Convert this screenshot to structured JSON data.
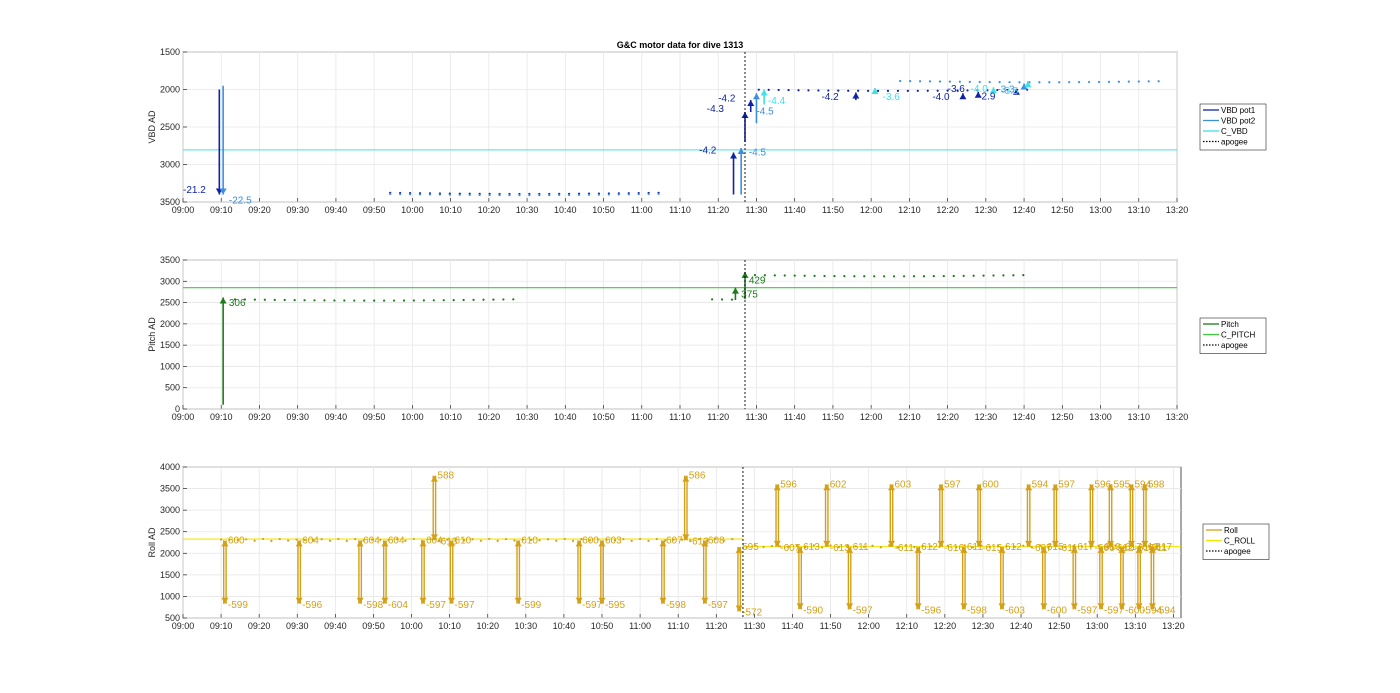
{
  "title": "G&C motor data for dive 1313",
  "x_ticks": [
    "09:00",
    "09:10",
    "09:20",
    "09:30",
    "09:40",
    "09:50",
    "10:00",
    "10:10",
    "10:20",
    "10:30",
    "10:40",
    "10:50",
    "11:00",
    "11:10",
    "11:20",
    "11:30",
    "11:40",
    "11:50",
    "12:00",
    "12:10",
    "12:20",
    "12:30",
    "12:40",
    "12:50",
    "13:00",
    "13:10",
    "13:20"
  ],
  "chart_data": [
    {
      "type": "line",
      "ylabel": "VBD AD",
      "ylim": [
        1500,
        3500
      ],
      "y_reversed": true,
      "yticks": [
        1500,
        2000,
        2500,
        3000,
        3500
      ],
      "xlim_minutes": [
        0,
        260
      ],
      "apogee_minute": 147,
      "grid": true,
      "legend_position": "right",
      "legend": [
        {
          "label": "VBD pot1",
          "color": "#0f23a8",
          "style": "solid"
        },
        {
          "label": "VBD pot2",
          "color": "#3b8fe0",
          "style": "solid"
        },
        {
          "label": "C_VBD",
          "color": "#40e0e8",
          "style": "solid"
        },
        {
          "label": "apogee",
          "color": "#000000",
          "style": "dotted"
        }
      ],
      "constant_line": {
        "name": "C_VBD",
        "y": 2805,
        "color": "#40e0e8"
      },
      "series": [
        {
          "name": "VBD pot1",
          "color": "#0f23a8",
          "baseline_segments": [
            [
              10,
              3380,
              146,
              3380
            ],
            [
              148,
              2005,
              256,
              2005
            ]
          ]
        },
        {
          "name": "VBD pot2",
          "color": "#3b8fe0",
          "baseline_segments": [
            [
              10,
              3395,
              146,
              3395
            ],
            [
              146,
              1890,
              256,
              1890
            ]
          ]
        }
      ],
      "arrows": [
        {
          "x": 9.5,
          "y0": 2000,
          "y1": 3400,
          "color": "#0f23a8",
          "label": "-21.2",
          "lx": 0,
          "ly": 3380
        },
        {
          "x": 10.5,
          "y0": 1950,
          "y1": 3400,
          "color": "#3b8fe0",
          "label": "-22.5",
          "lx": 12,
          "ly": 3520
        },
        {
          "x": 144,
          "y0": 3400,
          "y1": 2840,
          "color": "#0f23a8",
          "label": "-4.2",
          "lx": 135,
          "ly": 2850
        },
        {
          "x": 146,
          "y0": 3400,
          "y1": 2780,
          "color": "#3b8fe0",
          "label": "-4.5",
          "lx": 148,
          "ly": 2880
        },
        {
          "x": 147,
          "y0": 2700,
          "y1": 2300,
          "color": "#0f23a8",
          "label": "-4.3",
          "lx": 137,
          "ly": 2300
        },
        {
          "x": 148.5,
          "y0": 2300,
          "y1": 2140,
          "color": "#0f23a8",
          "label": "-4.2",
          "lx": 140,
          "ly": 2160
        },
        {
          "x": 150,
          "y0": 2450,
          "y1": 2050,
          "color": "#3b8fe0",
          "label": "-4.5",
          "lx": 150,
          "ly": 2330
        },
        {
          "x": 152,
          "y0": 2200,
          "y1": 2000,
          "color": "#40e0e8",
          "label": "-4.4",
          "lx": 153,
          "ly": 2190
        },
        {
          "x": 176,
          "y0": 2140,
          "y1": 2040,
          "color": "#0f23a8",
          "label": "-4.2",
          "lx": 167,
          "ly": 2140
        },
        {
          "x": 181,
          "y0": 2050,
          "y1": 1980,
          "color": "#40e0e8",
          "label": "-3.6",
          "lx": 183,
          "ly": 2140
        },
        {
          "x": 204,
          "y0": 2090,
          "y1": 2050,
          "color": "#0f23a8",
          "label": "-4.0",
          "lx": 196,
          "ly": 2140
        },
        {
          "x": 208,
          "y0": 2070,
          "y1": 2030,
          "color": "#0f23a8",
          "label": "-3.6",
          "lx": 200,
          "ly": 2030
        },
        {
          "x": 212,
          "y0": 2020,
          "y1": 1970,
          "color": "#40e0e8",
          "label": "-4.0",
          "lx": 206,
          "ly": 2030
        },
        {
          "x": 218,
          "y0": 2040,
          "y1": 1990,
          "color": "#0f23a8",
          "label": "-2.9",
          "lx": 208,
          "ly": 2130
        },
        {
          "x": 220,
          "y0": 2000,
          "y1": 1920,
          "color": "#3b8fe0",
          "label": "-3.3",
          "lx": 213,
          "ly": 2040
        },
        {
          "x": 221,
          "y0": 1960,
          "y1": 1890,
          "color": "#40e0e8",
          "label": "-3.5",
          "lx": 214,
          "ly": 2060
        }
      ]
    },
    {
      "type": "line",
      "ylabel": "Pitch AD",
      "ylim": [
        0,
        3500
      ],
      "yticks": [
        0,
        500,
        1000,
        1500,
        2000,
        2500,
        3000,
        3500
      ],
      "xlim_minutes": [
        0,
        260
      ],
      "apogee_minute": 147,
      "grid": true,
      "legend_position": "right",
      "legend": [
        {
          "label": "Pitch",
          "color": "#1b7a1b",
          "style": "solid"
        },
        {
          "label": "C_PITCH",
          "color": "#3ccc3c",
          "style": "solid"
        },
        {
          "label": "apogee",
          "color": "#000000",
          "style": "dotted"
        }
      ],
      "constant_line": {
        "name": "C_PITCH",
        "y": 2850,
        "color": "#3ccc3c"
      },
      "series": [
        {
          "name": "Pitch",
          "color": "#1b7a1b",
          "baseline_segments": [
            [
              11,
              2570,
              145,
              2570
            ],
            [
              147,
              3140,
              256,
              3140
            ]
          ]
        }
      ],
      "arrows": [
        {
          "x": 10.5,
          "y0": 100,
          "y1": 2620,
          "color": "#1b7a1b",
          "label": "306",
          "lx": 12,
          "ly": 2420
        },
        {
          "x": 144.5,
          "y0": 2560,
          "y1": 2850,
          "color": "#1b7a1b",
          "label": "",
          "lx": 0,
          "ly": 0
        },
        {
          "x": 147,
          "y0": 2580,
          "y1": 3220,
          "color": "#1b7a1b",
          "label": "429",
          "lx": 148,
          "ly": 2950
        },
        {
          "x": 147,
          "y0": 0,
          "y1": 0,
          "color": "#1b7a1b",
          "label": "375",
          "lx": 146,
          "ly": 2620
        }
      ]
    },
    {
      "type": "line",
      "ylabel": "Roll AD",
      "ylim": [
        500,
        4000
      ],
      "yticks": [
        500,
        1000,
        1500,
        2000,
        2500,
        3000,
        3500,
        4000
      ],
      "xlim_minutes": [
        0,
        262
      ],
      "apogee_minute": 147,
      "grid": true,
      "legend_position": "right",
      "legend": [
        {
          "label": "Roll",
          "color": "#d4a017",
          "style": "solid"
        },
        {
          "label": "C_ROLL",
          "color": "#f2e600",
          "style": "solid"
        },
        {
          "label": "apogee",
          "color": "#000000",
          "style": "dotted"
        }
      ],
      "constant_line": {
        "name": "C_ROLL",
        "y1": 2330,
        "y2": 2160,
        "color": "#f2e600"
      },
      "series": [
        {
          "name": "Roll",
          "color": "#d4a017",
          "baseline_segments": [
            [
              10,
              2310,
              145,
              2310
            ],
            [
              148,
              2160,
              256,
              2160
            ]
          ]
        }
      ],
      "spikes": [
        {
          "x": 11,
          "top": 2300,
          "bot": 830,
          "labels": [
            "600",
            "-599"
          ]
        },
        {
          "x": 30.5,
          "top": 2300,
          "bot": 830,
          "labels": [
            "604",
            "-596"
          ]
        },
        {
          "x": 46.5,
          "top": 2300,
          "bot": 830,
          "labels": [
            "604",
            "-598"
          ]
        },
        {
          "x": 53,
          "top": 2300,
          "bot": 830,
          "labels": [
            "604",
            "-604"
          ]
        },
        {
          "x": 63,
          "top": 2300,
          "bot": 830,
          "labels": [
            "604",
            "-597"
          ]
        },
        {
          "x": 66,
          "top": 3800,
          "bot": 2300,
          "labels": [
            "588",
            "-613"
          ]
        },
        {
          "x": 70.5,
          "top": 2300,
          "bot": 830,
          "labels": [
            "610",
            "-597"
          ]
        },
        {
          "x": 88,
          "top": 2300,
          "bot": 830,
          "labels": [
            "610",
            "-599"
          ]
        },
        {
          "x": 104,
          "top": 2300,
          "bot": 830,
          "labels": [
            "600",
            "-597"
          ]
        },
        {
          "x": 110,
          "top": 2300,
          "bot": 830,
          "labels": [
            "603",
            "-595"
          ]
        },
        {
          "x": 126,
          "top": 2300,
          "bot": 830,
          "labels": [
            "607",
            "-598"
          ]
        },
        {
          "x": 132,
          "top": 3800,
          "bot": 2300,
          "labels": [
            "586",
            "-613"
          ]
        },
        {
          "x": 137,
          "top": 2300,
          "bot": 830,
          "labels": [
            "608",
            "-597"
          ]
        },
        {
          "x": 146,
          "top": 2150,
          "bot": 650,
          "labels": [
            "595",
            "-572"
          ]
        },
        {
          "x": 156,
          "top": 3600,
          "bot": 2150,
          "labels": [
            "596",
            "-607"
          ]
        },
        {
          "x": 162,
          "top": 2150,
          "bot": 700,
          "labels": [
            "613",
            "-590"
          ]
        },
        {
          "x": 169,
          "top": 3600,
          "bot": 2150,
          "labels": [
            "602",
            "-613"
          ]
        },
        {
          "x": 175,
          "top": 2150,
          "bot": 700,
          "labels": [
            "611",
            "-597"
          ]
        },
        {
          "x": 186,
          "top": 3600,
          "bot": 2150,
          "labels": [
            "603",
            "-611"
          ]
        },
        {
          "x": 193,
          "top": 2150,
          "bot": 700,
          "labels": [
            "612",
            "-596"
          ]
        },
        {
          "x": 199,
          "top": 3600,
          "bot": 2150,
          "labels": [
            "597",
            "-616"
          ]
        },
        {
          "x": 205,
          "top": 2150,
          "bot": 700,
          "labels": [
            "611",
            "-598"
          ]
        },
        {
          "x": 209,
          "top": 3600,
          "bot": 2150,
          "labels": [
            "600",
            "-615"
          ]
        },
        {
          "x": 215,
          "top": 2150,
          "bot": 700,
          "labels": [
            "612",
            "-603"
          ]
        },
        {
          "x": 222,
          "top": 3600,
          "bot": 2150,
          "labels": [
            "594",
            "-607"
          ]
        },
        {
          "x": 226,
          "top": 2150,
          "bot": 700,
          "labels": [
            "615",
            "-600"
          ]
        },
        {
          "x": 229,
          "top": 3600,
          "bot": 2150,
          "labels": [
            "597",
            "-611"
          ]
        },
        {
          "x": 234,
          "top": 2150,
          "bot": 700,
          "labels": [
            "617",
            "-597"
          ]
        },
        {
          "x": 238.5,
          "top": 3600,
          "bot": 2150,
          "labels": [
            "596",
            "-606"
          ]
        },
        {
          "x": 241,
          "top": 2150,
          "bot": 700,
          "labels": [
            "610",
            "-597"
          ]
        },
        {
          "x": 243.5,
          "top": 3600,
          "bot": 2150,
          "labels": [
            "595",
            "-612"
          ]
        },
        {
          "x": 246.5,
          "top": 2150,
          "bot": 700,
          "labels": [
            "617",
            "-600"
          ]
        },
        {
          "x": 249,
          "top": 3600,
          "bot": 2150,
          "labels": [
            "594",
            "-616"
          ]
        },
        {
          "x": 251,
          "top": 2150,
          "bot": 700,
          "labels": [
            "613",
            "-594"
          ]
        },
        {
          "x": 252.5,
          "top": 3600,
          "bot": 2150,
          "labels": [
            "598",
            "-611"
          ]
        },
        {
          "x": 254.5,
          "top": 2150,
          "bot": 700,
          "labels": [
            "617",
            "-594"
          ]
        }
      ]
    }
  ]
}
